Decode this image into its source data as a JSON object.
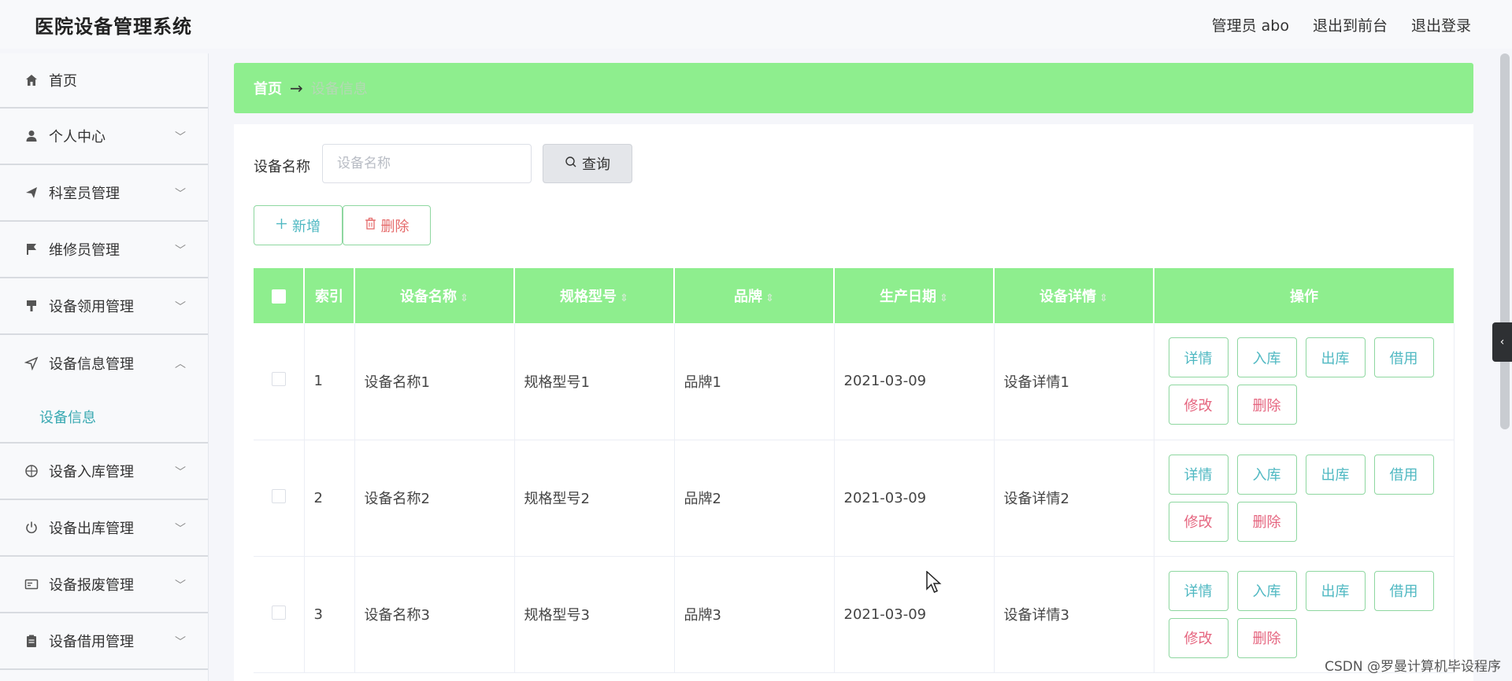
{
  "header": {
    "title": "医院设备管理系统",
    "user": "管理员 abo",
    "to_front": "退出到前台",
    "logout": "退出登录"
  },
  "sidebar": {
    "items": [
      {
        "label": "首页",
        "icon": "home-icon"
      },
      {
        "label": "个人中心",
        "icon": "user-icon"
      },
      {
        "label": "科室员管理",
        "icon": "send-icon"
      },
      {
        "label": "维修员管理",
        "icon": "flag-icon"
      },
      {
        "label": "设备领用管理",
        "icon": "brush-icon"
      },
      {
        "label": "设备信息管理",
        "icon": "location-icon",
        "submenu": "设备信息"
      },
      {
        "label": "设备入库管理",
        "icon": "basketball-icon"
      },
      {
        "label": "设备出库管理",
        "icon": "power-icon"
      },
      {
        "label": "设备报废管理",
        "icon": "postcard-icon"
      },
      {
        "label": "设备借用管理",
        "icon": "clipboard-icon"
      }
    ]
  },
  "breadcrumb": {
    "home": "首页",
    "arrow": "→",
    "current": "设备信息"
  },
  "search": {
    "label": "设备名称",
    "placeholder": "设备名称",
    "button": "查询"
  },
  "actions": {
    "add": "新增",
    "delete": "删除"
  },
  "table": {
    "columns": [
      "索引",
      "设备名称",
      "规格型号",
      "品牌",
      "生产日期",
      "设备详情",
      "操作"
    ],
    "rows": [
      {
        "index": "1",
        "name": "设备名称1",
        "model": "规格型号1",
        "brand": "品牌1",
        "date": "2021-03-09",
        "detail": "设备详情1"
      },
      {
        "index": "2",
        "name": "设备名称2",
        "model": "规格型号2",
        "brand": "品牌2",
        "date": "2021-03-09",
        "detail": "设备详情2"
      },
      {
        "index": "3",
        "name": "设备名称3",
        "model": "规格型号3",
        "brand": "品牌3",
        "date": "2021-03-09",
        "detail": "设备详情3"
      }
    ],
    "ops": {
      "detail": "详情",
      "stock_in": "入库",
      "stock_out": "出库",
      "borrow": "借用",
      "edit": "修改",
      "delete": "删除"
    }
  },
  "collapse_glyph": "‹",
  "watermark": "CSDN @罗曼计算机毕设程序",
  "colors": {
    "accent_green": "#8eee8e",
    "teal_text": "#4fb8c2",
    "red_text": "#e5657f"
  }
}
